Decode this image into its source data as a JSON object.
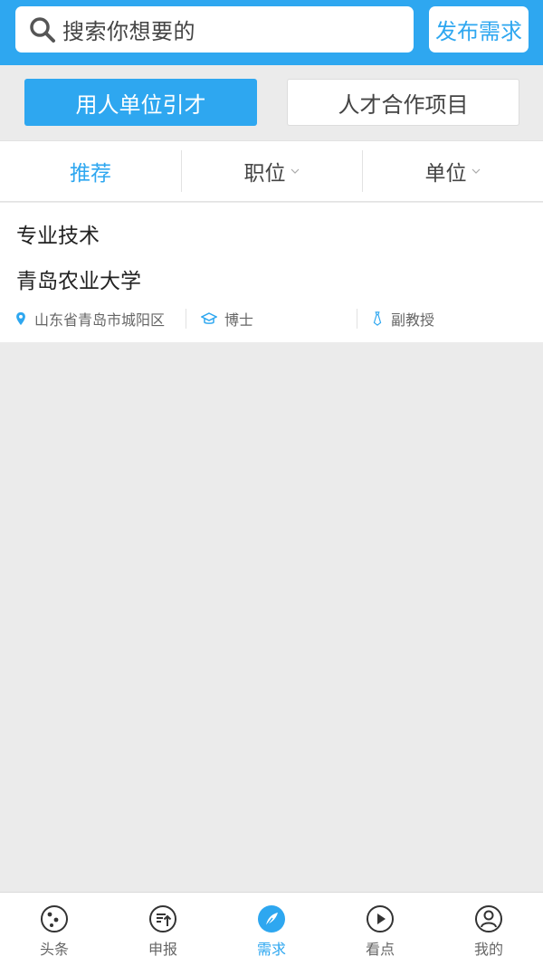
{
  "header": {
    "search_placeholder": "搜索你想要的",
    "publish_label": "发布需求"
  },
  "segments": {
    "active_label": "用人单位引才",
    "inactive_label": "人才合作项目"
  },
  "filters": [
    {
      "label": "推荐",
      "active": true
    },
    {
      "label": "职位",
      "active": false
    },
    {
      "label": "单位",
      "active": false
    }
  ],
  "listing": {
    "category": "专业技术",
    "organization": "青岛农业大学",
    "location": "山东省青岛市城阳区",
    "degree": "博士",
    "title": "副教授"
  },
  "nav": [
    {
      "label": "头条",
      "icon": "headline-icon"
    },
    {
      "label": "申报",
      "icon": "declare-icon"
    },
    {
      "label": "需求",
      "icon": "demand-icon",
      "active": true
    },
    {
      "label": "看点",
      "icon": "play-icon"
    },
    {
      "label": "我的",
      "icon": "profile-icon"
    }
  ],
  "colors": {
    "accent": "#2ea7f0",
    "background": "#ebebeb"
  }
}
